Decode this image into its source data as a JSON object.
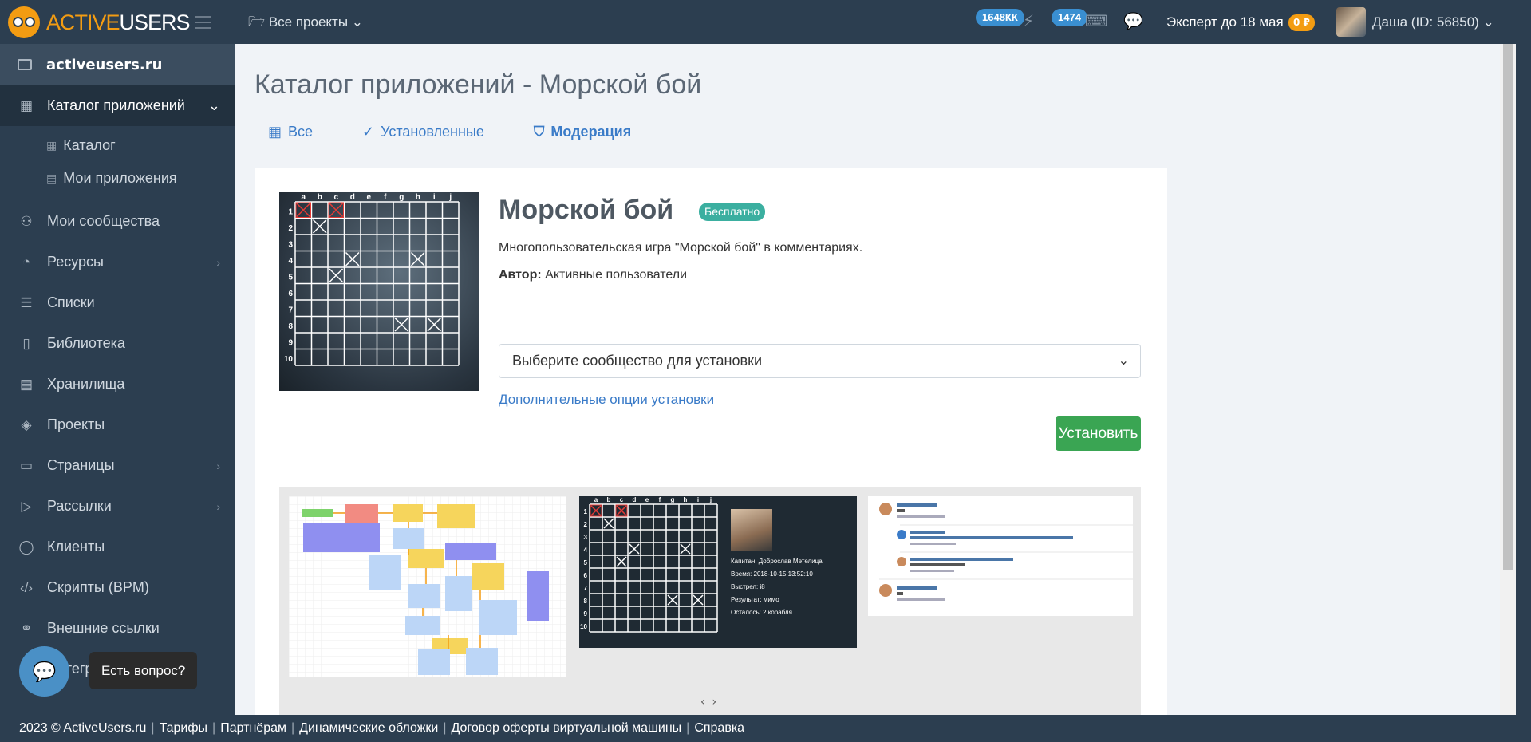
{
  "header": {
    "logo_prefix": "ACTIVE",
    "logo_suffix": "USERS",
    "projects_label": "Все проекты",
    "badge1": "1648КК",
    "badge2": "1474",
    "expert_label": "Эксперт до 18 мая",
    "balance": "0 ₽",
    "user_label": "Даша (ID: 56850)"
  },
  "sidebar": {
    "site": "activeusers.ru",
    "active_item": "Каталог приложений",
    "sub_items": [
      "Каталог",
      "Мои приложения"
    ],
    "items": [
      {
        "label": "Мои сообщества",
        "icon": "users-icon"
      },
      {
        "label": "Ресурсы",
        "icon": "resources-icon",
        "arrow": "›"
      },
      {
        "label": "Списки",
        "icon": "list-icon"
      },
      {
        "label": "Библиотека",
        "icon": "book-icon"
      },
      {
        "label": "Хранилища",
        "icon": "storage-icon"
      },
      {
        "label": "Проекты",
        "icon": "layers-icon"
      },
      {
        "label": "Страницы",
        "icon": "page-icon",
        "arrow": "›"
      },
      {
        "label": "Рассылки",
        "icon": "send-icon",
        "arrow": "›"
      },
      {
        "label": "Клиенты",
        "icon": "client-icon"
      },
      {
        "label": "Скрипты (BPM)",
        "icon": "code-icon"
      },
      {
        "label": "Внешние ссылки",
        "icon": "link-icon"
      },
      {
        "label": "Интегр",
        "icon": "integration-icon"
      }
    ]
  },
  "main": {
    "title": "Каталог приложений - Морской бой",
    "tabs": [
      {
        "label": "Все",
        "icon": "grid-icon"
      },
      {
        "label": "Установленные",
        "icon": "check-icon"
      },
      {
        "label": "Модерация",
        "icon": "shield-icon"
      }
    ]
  },
  "app": {
    "name": "Морской бой",
    "price_badge": "Бесплатно",
    "description": "Многопользовательская игра \"Морской бой\" в комментариях.",
    "author_label": "Автор:",
    "author": "Активные пользователи",
    "select_placeholder": "Выберите сообщество для установки",
    "extra_options": "Дополнительные опции установки",
    "install_button": "Установить",
    "board_cols": [
      "a",
      "b",
      "c",
      "d",
      "e",
      "f",
      "g",
      "h",
      "i",
      "j"
    ],
    "board_rows": [
      "1",
      "2",
      "3",
      "4",
      "5",
      "6",
      "7",
      "8",
      "9",
      "10"
    ]
  },
  "gallery": {
    "shot2_lines": [
      "Капитан: Доброслав Метелица",
      "Время: 2018-10-15 13:52:10",
      "Выстрел: i8",
      "Результат: мимо",
      "Осталось: 2 корабля"
    ],
    "nav_prev": "‹",
    "nav_next": "›"
  },
  "footer": {
    "copyright": "2023 ©",
    "site": "ActiveUsers.ru",
    "links": [
      "Тарифы",
      "Партнёрам",
      "Динамические обложки",
      "Договор оферты виртуальной машины",
      "Справка"
    ]
  },
  "chat": {
    "tooltip": "Есть вопрос?"
  }
}
